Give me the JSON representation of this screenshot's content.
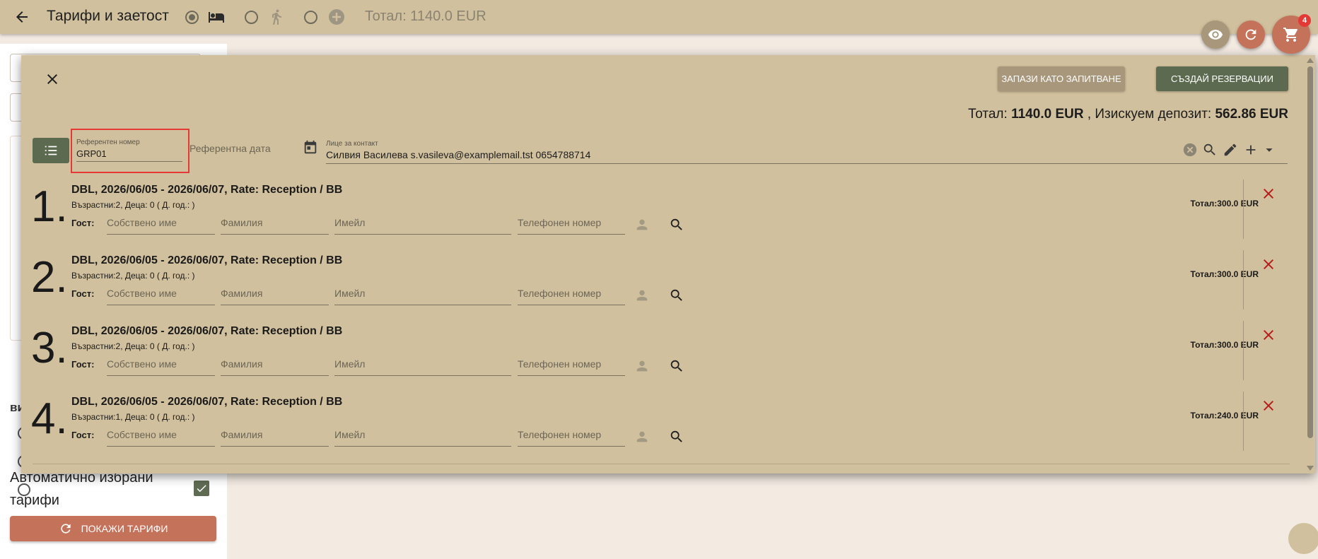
{
  "topbar": {
    "title": "Тарифи и заетост",
    "total": "Тотал: 1140.0 EUR",
    "cart_count": "4"
  },
  "left_panel": {
    "section_label": "ви",
    "auto_label": "Автоматично избрани тарифи",
    "show_button": "ПОКАЖИ ТАРИФИ"
  },
  "modal": {
    "save_request_button": "ЗАПАЗИ КАТО ЗАПИТВАНЕ",
    "create_button": "СЪЗДАЙ РЕЗЕРВАЦИИ",
    "totals": {
      "total_label": "Тотал: ",
      "total_value": "1140.0 EUR",
      "deposit_label": " , Изискуем депозит: ",
      "deposit_value": "562.86 EUR"
    },
    "ref_number": {
      "label": "Референтен номер",
      "value": "GRP01"
    },
    "ref_date": {
      "placeholder": "Референтна дата"
    },
    "contact": {
      "label": "Лице за контакт",
      "value": "Силвия Василева s.vasileva@examplemail.tst 0654788714"
    },
    "guest_label": "Гост:",
    "placeholders": {
      "first_name": "Собствено име",
      "last_name": "Фамилия",
      "email": "Имейл",
      "phone": "Телефонен номер"
    },
    "reservations": [
      {
        "num": "1.",
        "title": "DBL, 2026/06/05 - 2026/06/07, Rate: Reception / BB",
        "occupancy": "Възрастни:2, Деца: 0 ( Д. год.: )",
        "total": "Тотал:300.0 EUR"
      },
      {
        "num": "2.",
        "title": "DBL, 2026/06/05 - 2026/06/07, Rate: Reception / BB",
        "occupancy": "Възрастни:2, Деца: 0 ( Д. год.: )",
        "total": "Тотал:300.0 EUR"
      },
      {
        "num": "3.",
        "title": "DBL, 2026/06/05 - 2026/06/07, Rate: Reception / BB",
        "occupancy": "Възрастни:2, Деца: 0 ( Д. год.: )",
        "total": "Тотал:300.0 EUR"
      },
      {
        "num": "4.",
        "title": "DBL, 2026/06/05 - 2026/06/07, Rate: Reception / BB",
        "occupancy": "Възрастни:1, Деца: 0 ( Д. год.: )",
        "total": "Тотал:240.0 EUR"
      }
    ]
  },
  "colors": {
    "topbar_bg": "#d1c09d",
    "modal_bg": "#d1c09d",
    "primary_green": "#5c6a4f",
    "secondary_tan": "#a8977a",
    "accent_coral": "#c5725b",
    "delete_red": "#b71c1c",
    "highlight_red": "#e53935"
  },
  "icons": {
    "back": "arrow-left-icon",
    "bed": "bed-icon",
    "walk": "walk-icon",
    "add": "plus-circle-icon",
    "eye": "eye-icon",
    "refresh": "refresh-icon",
    "cart": "cart-icon",
    "close": "close-icon",
    "list": "list-icon",
    "calendar": "calendar-icon",
    "clear": "clear-icon",
    "search": "search-icon",
    "edit": "pencil-icon",
    "plus": "plus-icon",
    "dropdown": "chevron-down-icon",
    "person": "person-icon",
    "delete": "delete-x-icon"
  }
}
